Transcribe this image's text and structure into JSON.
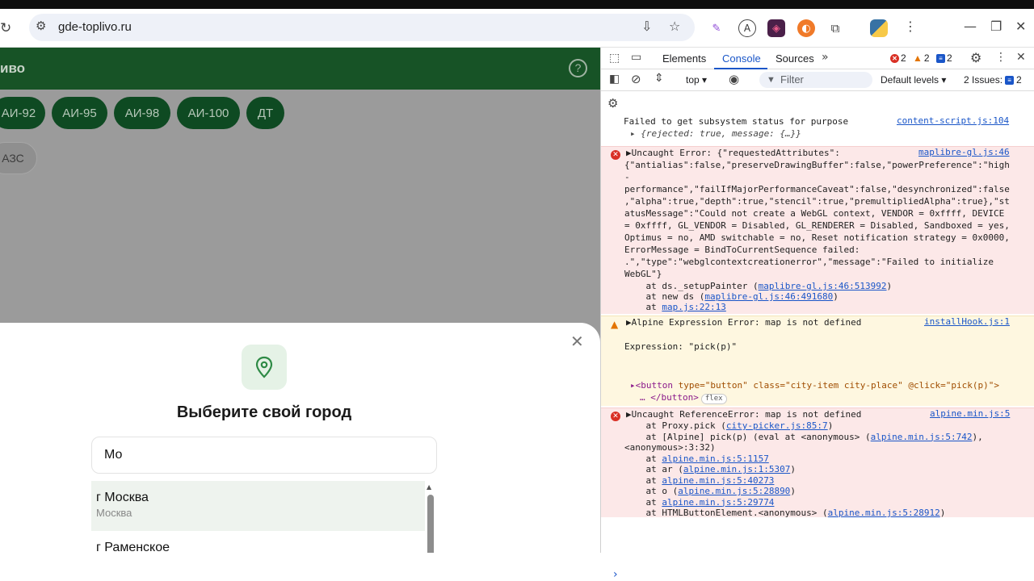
{
  "browser": {
    "url": "gde-toplivo.ru"
  },
  "site": {
    "title_fragment": "иво",
    "help_label": "?",
    "fuel_chips": [
      "АИ-92",
      "АИ-95",
      "АИ-98",
      "АИ-100",
      "ДТ"
    ],
    "azs_chip": "АЗС"
  },
  "modal": {
    "title": "Выберите свой город",
    "input_value": "Мо",
    "items": [
      {
        "name": "г Москва",
        "sub": "Москва"
      },
      {
        "name": "г Раменское",
        "sub": ""
      }
    ]
  },
  "devtools": {
    "tabs": [
      "Elements",
      "Console",
      "Sources"
    ],
    "active_tab": "Console",
    "error_count": "2",
    "warning_count": "2",
    "info_count": "2",
    "context": "top",
    "filter_placeholder": "Filter",
    "levels": "Default levels",
    "issues": "2 Issues:",
    "issues_count": "2",
    "messages": {
      "m1": {
        "text": "Failed to get subsystem status for purpose",
        "detail": "▸ {rejected: true, message: {…}}",
        "source": "content-script.js:104"
      },
      "m2": {
        "lines": [
          "▶Uncaught Error: {\"requestedAttributes\":",
          "{\"antialias\":false,\"preserveDrawingBuffer\":false,\"powerPreference\":\"high",
          "-",
          "performance\",\"failIfMajorPerformanceCaveat\":false,\"desynchronized\":false",
          ",\"alpha\":true,\"depth\":true,\"stencil\":true,\"premultipliedAlpha\":true},\"st",
          "atusMessage\":\"Could not create a WebGL context, VENDOR = 0xffff, DEVICE",
          "= 0xffff, GL_VENDOR = Disabled, GL_RENDERER = Disabled, Sandboxed = yes,",
          "Optimus = no, AMD switchable = no, Reset notification strategy = 0x0000,",
          "ErrorMessage = BindToCurrentSequence failed:",
          ".\",\"type\":\"webglcontextcreationerror\",\"message\":\"Failed to initialize",
          "WebGL\"}"
        ],
        "stack": [
          {
            "prefix": "    at ds._setupPainter (",
            "link": "maplibre-gl.js:46:513992",
            "suffix": ")"
          },
          {
            "prefix": "    at new ds (",
            "link": "maplibre-gl.js:46:491680",
            "suffix": ")"
          },
          {
            "prefix": "    at ",
            "link": "map.js:22:13",
            "suffix": ""
          }
        ],
        "source": "maplibre-gl.js:46"
      },
      "m3": {
        "text": "▶Alpine Expression Error: map is not defined",
        "expr": "Expression: \"pick(p)\"",
        "el_tag_open": "▸<button",
        "el_attrs": " type=\"button\" class=\"city-item city-place\" @click=\"pick(p)\">",
        "el_close": "… </button>",
        "flex": "flex",
        "source": "installHook.js:1"
      },
      "m4": {
        "text": "▶Uncaught ReferenceError: map is not defined",
        "stack": [
          {
            "prefix": "    at Proxy.pick (",
            "link": "city-picker.js:85:7",
            "suffix": ")"
          },
          {
            "prefix": "    at [Alpine] pick(p) (eval at <anonymous> (",
            "link": "alpine.min.js:5:742",
            "suffix": "),"
          },
          {
            "prefix": "<anonymous>:3:32)",
            "link": "",
            "suffix": ""
          },
          {
            "prefix": "    at ",
            "link": "alpine.min.js:5:1157",
            "suffix": ""
          },
          {
            "prefix": "    at ar (",
            "link": "alpine.min.js:1:5307",
            "suffix": ")"
          },
          {
            "prefix": "    at ",
            "link": "alpine.min.js:5:40273",
            "suffix": ""
          },
          {
            "prefix": "    at o (",
            "link": "alpine.min.js:5:28890",
            "suffix": ")"
          },
          {
            "prefix": "    at ",
            "link": "alpine.min.js:5:29774",
            "suffix": ""
          },
          {
            "prefix": "    at HTMLButtonElement.<anonymous> (",
            "link": "alpine.min.js:5:28912",
            "suffix": ")"
          }
        ],
        "source": "alpine.min.js:5"
      }
    },
    "prompt": "›"
  },
  "colors": {
    "site_green": "#175326",
    "chip_green": "#0e4a22",
    "error_bg": "#fce8e8",
    "warn_bg": "#fef7e0",
    "link_blue": "#1a56c8"
  },
  "icons": [
    "reload-icon",
    "tune-icon",
    "install-icon",
    "bookmark-star-icon",
    "pen-extension-icon",
    "translate-extension-icon",
    "puzzle-icon",
    "python-icon",
    "menu-icon",
    "location-pin-icon",
    "close-icon"
  ]
}
